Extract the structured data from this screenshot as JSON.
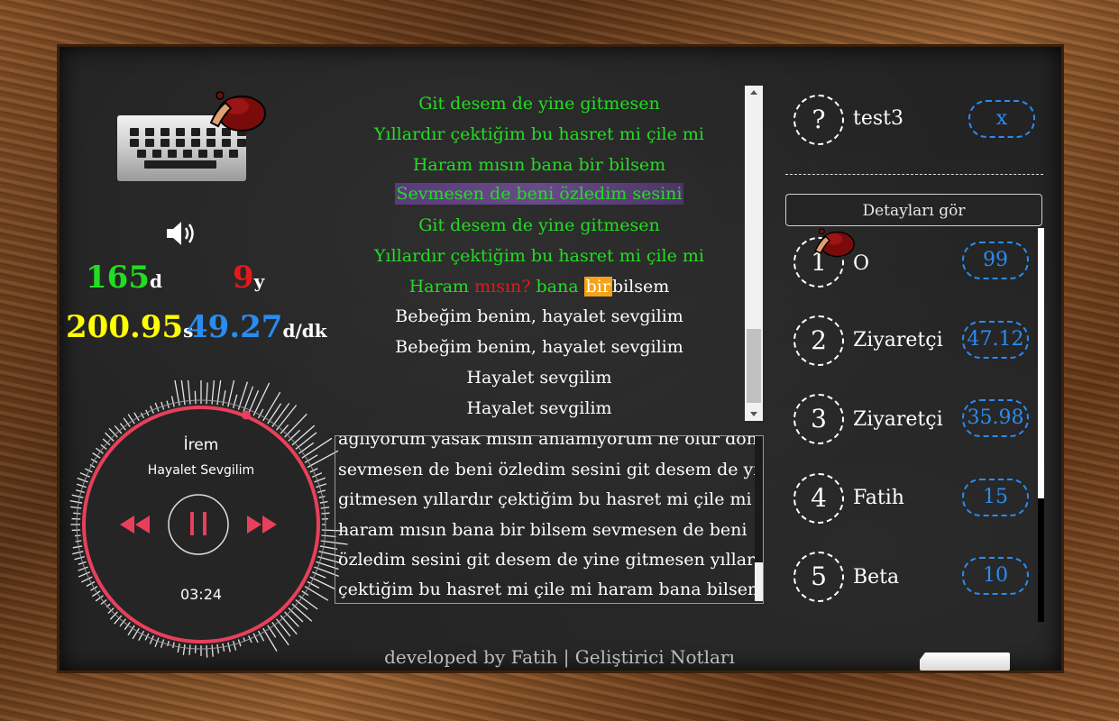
{
  "colors": {
    "accent_green": "#22dd22",
    "accent_red": "#e41919",
    "accent_yellow": "#ffff00",
    "accent_blue": "#2a8cf0",
    "player_red": "#e8405a",
    "highlight_orange": "#f5a31a"
  },
  "stats": {
    "correct_value": "165",
    "correct_unit": "d",
    "wrong_value": "9",
    "wrong_unit": "y",
    "seconds_value": "200.95",
    "seconds_unit": "s",
    "speed_value": "49.27",
    "speed_unit": "d/dk"
  },
  "player": {
    "artist": "İrem",
    "song": "Hayalet Sevgilim",
    "time": "03:24",
    "progress": 0.03,
    "icons": [
      "rewind-icon",
      "pause-icon",
      "fast-forward-icon"
    ]
  },
  "lyrics": {
    "lines": [
      "Git desem de yine gitmesen",
      "Yıllardır çektiğim bu hasret mi çile mi",
      "Haram mısın bana bir bilsem",
      "Sevmesen de beni özledim sesini",
      "Git desem de yine gitmesen",
      "Yıllardır çektiğim bu hasret mi çile mi"
    ],
    "current": {
      "typed": "Haram",
      "wrong": "mısın?",
      "ok": "bana",
      "active_word": "bir",
      "rest": "bilsem"
    },
    "upcoming": [
      "Bebeğim benim, hayalet sevgilim",
      "Bebeğim benim, hayalet sevgilim",
      "Hayalet sevgilim",
      "Hayalet sevgilim"
    ]
  },
  "typed_text": {
    "lines": [
      "ağlıyorum yasak mısın anlamıyorum ne olur dön",
      "sevmesen de beni özledim sesini git desem de yine",
      "gitmesen yıllardır çektiğim bu hasret mi çile mi",
      "haram mısın bana bir bilsem sevmesen de beni",
      "özledim sesini git desem de yine gitmesen yıllardır",
      "çektiğim bu hasret mi çile mi haram  bana bilsem"
    ]
  },
  "user": {
    "avatar_symbol": "?",
    "name": "test3",
    "close_label": "x"
  },
  "leaderboard": {
    "details_label": "Detayları gör",
    "entries": [
      {
        "rank": "1",
        "name": "O",
        "score": "99"
      },
      {
        "rank": "2",
        "name": "Ziyaretçi",
        "score": "47.12"
      },
      {
        "rank": "3",
        "name": "Ziyaretçi",
        "score": "35.98"
      },
      {
        "rank": "4",
        "name": "Fatih",
        "score": "15"
      },
      {
        "rank": "5",
        "name": "Beta",
        "score": "10"
      }
    ]
  },
  "footer": {
    "text": "developed by Fatih | Geliştirici Notları"
  }
}
